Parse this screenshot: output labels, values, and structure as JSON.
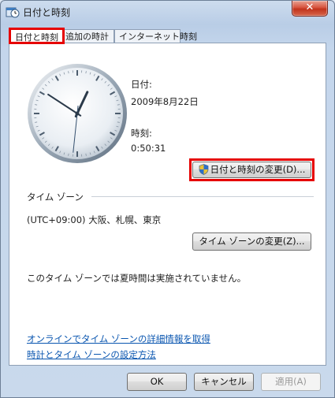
{
  "window": {
    "title": "日付と時刻",
    "close_label": "✕"
  },
  "tabs": [
    {
      "label": "日付と時刻",
      "active": true
    },
    {
      "label": "追加の時計",
      "active": false
    },
    {
      "label": "インターネット時刻",
      "active": false
    }
  ],
  "datetime": {
    "date_label": "日付:",
    "date_value": "2009年8月22日",
    "time_label": "時刻:",
    "time_value": "0:50:31",
    "change_button": "日付と時刻の変更(D)..."
  },
  "clock": {
    "hour": 0,
    "minute": 50,
    "second": 31
  },
  "timezone": {
    "group_label": "タイム ゾーン",
    "value": "(UTC+09:00) 大阪、札幌、東京",
    "change_button": "タイム ゾーンの変更(Z)...",
    "dst_note": "このタイム ゾーンでは夏時間は実施されていません。"
  },
  "links": {
    "online_info": "オンラインでタイム ゾーンの詳細情報を取得",
    "how_to": "時計とタイム ゾーンの設定方法"
  },
  "footer": {
    "ok": "OK",
    "cancel": "キャンセル",
    "apply": "適用(A)"
  },
  "colors": {
    "highlight": "#e60000",
    "link": "#0a56b0"
  }
}
